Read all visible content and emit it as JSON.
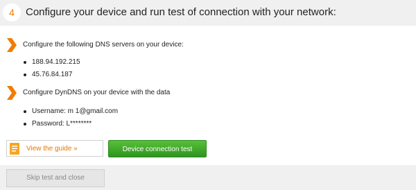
{
  "header": {
    "step_number": "4",
    "title": "Configure your device and run test of connection with your network:"
  },
  "dns_section": {
    "heading": "Configure the following DNS servers on your device:",
    "servers": [
      "188.94.192.215",
      "45.76.84.187"
    ]
  },
  "dyndns_section": {
    "heading": "Configure DynDNS on your device with the data",
    "items": [
      "Username: m           1@gmail.com",
      "Password: L********"
    ]
  },
  "actions": {
    "guide_label": "View the guide »",
    "test_label": "Device connection test",
    "skip_label": "Skip test and close"
  },
  "colors": {
    "accent": "#f07d00",
    "test_button": "#3fa528",
    "header_background": "#f0f0f0"
  },
  "icons": {
    "section_marker": "chevron-right-icon",
    "guide": "document-icon"
  }
}
